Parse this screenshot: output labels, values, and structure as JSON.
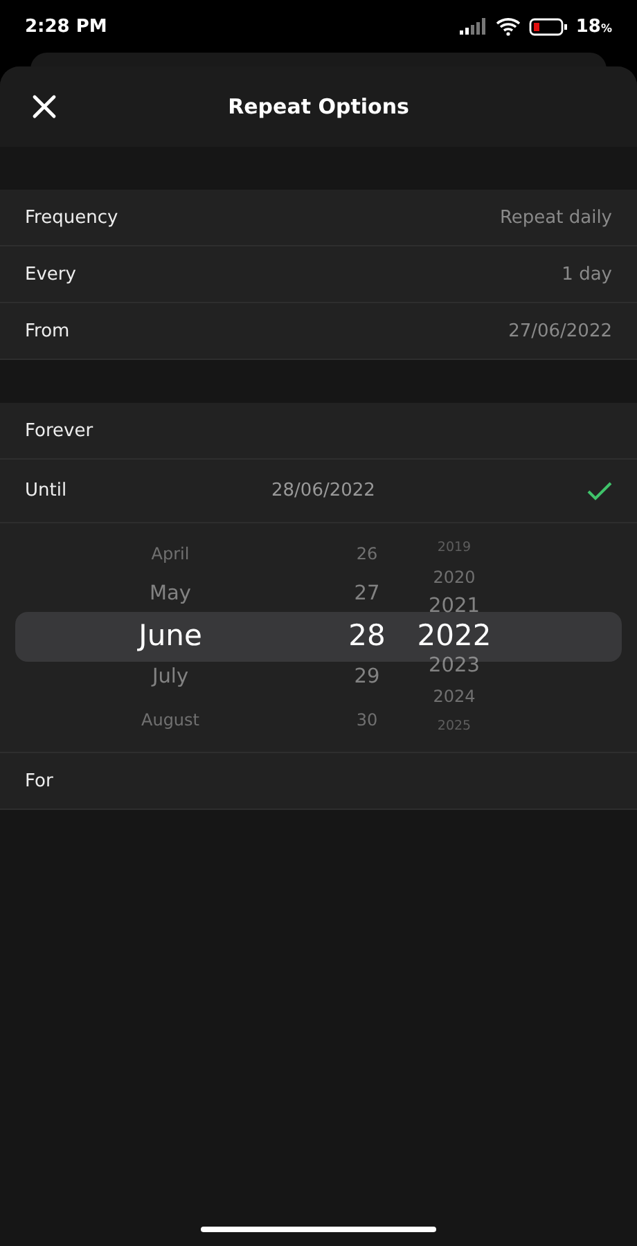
{
  "status_bar": {
    "time": "2:28 PM",
    "battery": "18",
    "battery_unit": "%"
  },
  "header": {
    "title": "Repeat Options"
  },
  "settings": [
    {
      "label": "Frequency",
      "value": "Repeat daily"
    },
    {
      "label": "Every",
      "value": "1 day"
    },
    {
      "label": "From",
      "value": "27/06/2022"
    }
  ],
  "end_options": [
    {
      "label": "Forever",
      "selected": false
    },
    {
      "label": "Until",
      "value": "28/06/2022",
      "selected": true
    }
  ],
  "picker": {
    "columns": [
      {
        "items": [
          {
            "text": "April",
            "selected": false
          },
          {
            "text": "May",
            "selected": false
          },
          {
            "text": "June",
            "selected": true
          },
          {
            "text": "July",
            "selected": false
          },
          {
            "text": "August",
            "selected": false
          }
        ]
      },
      {
        "items": [
          {
            "text": "26",
            "selected": false
          },
          {
            "text": "27",
            "selected": false
          },
          {
            "text": "28",
            "selected": true
          },
          {
            "text": "29",
            "selected": false
          },
          {
            "text": "30",
            "selected": false
          }
        ]
      },
      {
        "items": [
          {
            "text": "2019",
            "selected": false
          },
          {
            "text": "2020",
            "selected": false
          },
          {
            "text": "2021",
            "selected": false
          },
          {
            "text": "2022",
            "selected": true
          },
          {
            "text": "2023",
            "selected": false
          },
          {
            "text": "2024",
            "selected": false
          },
          {
            "text": "2025",
            "selected": false
          }
        ]
      }
    ]
  },
  "for_option": {
    "label": "For"
  }
}
